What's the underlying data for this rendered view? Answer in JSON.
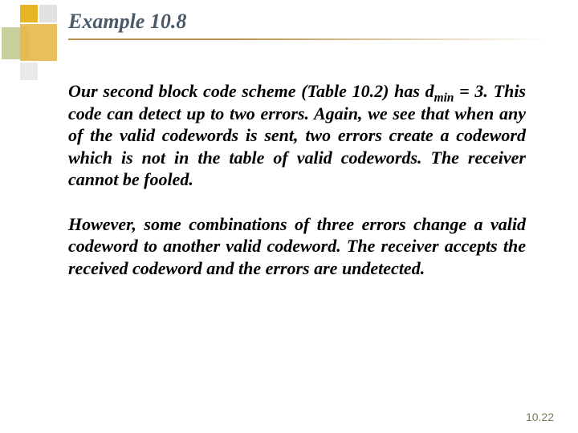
{
  "title": "Example 10.8",
  "paragraph1_a": "Our second block code scheme (Table 10.2) has d",
  "paragraph1_sub": "min",
  "paragraph1_b": " = 3. This code can detect up to two errors. Again, we see that when any of the valid codewords is sent, two errors create a codeword which is not in the table of valid codewords. The receiver cannot be fooled.",
  "paragraph2": "However, some combinations of three errors change a valid codeword to another valid codeword. The receiver accepts the received codeword and the errors are undetected.",
  "footer": "10.22"
}
